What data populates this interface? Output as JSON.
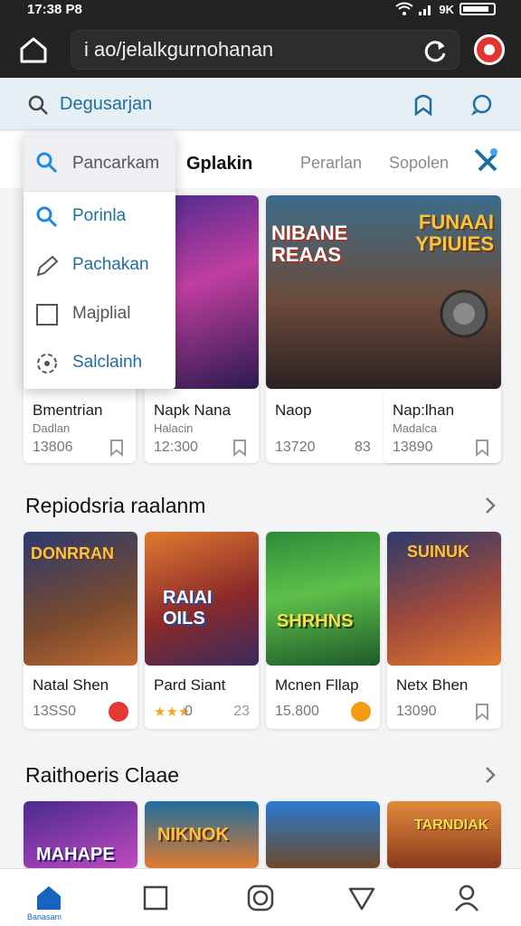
{
  "status": {
    "time": "17:38 P8",
    "signal_text": "9K"
  },
  "browser": {
    "url": "i ao/jelalkgurnohanan"
  },
  "search": {
    "placeholder": "Degusarjan"
  },
  "tabs": [
    {
      "label": "Gplakin",
      "active": true
    },
    {
      "label": "Perarlan",
      "active": false
    },
    {
      "label": "Sopolen",
      "active": false
    }
  ],
  "dropdown": {
    "header": "Pancarkam",
    "items": [
      {
        "label": "Porinla",
        "icon": "search-icon"
      },
      {
        "label": "Pachakan",
        "icon": "pencil-icon"
      },
      {
        "label": "Majplial",
        "icon": "checkbox-icon"
      },
      {
        "label": "Salclainh",
        "icon": "gear-icon"
      }
    ]
  },
  "top_row": [
    {
      "title": "Bmentrian",
      "subtitle": "Dadlan",
      "count": "13806",
      "art_caption": ""
    },
    {
      "title": "Napk Nana",
      "subtitle": "Halacin",
      "count": "12:300",
      "art_caption": ""
    },
    {
      "title": "Naop",
      "subtitle": "",
      "count": "13720",
      "badge": "83",
      "art_caption": "NIBANE REAAS",
      "art_caption2": "FUNAAI YPIUIES"
    },
    {
      "title": "Nap:lhan",
      "subtitle": "Madalca",
      "count": "13890",
      "art_caption": ""
    }
  ],
  "sections": [
    {
      "title": "Repiodsria raalanm"
    },
    {
      "title": "Raithoeris Claae"
    }
  ],
  "recommended": [
    {
      "title": "Natal Shen",
      "count": "13SS0",
      "art_caption": "DONRRAN",
      "badge_color": "#e53935"
    },
    {
      "title": "Pard Siant",
      "count": "0",
      "stars": "★★★",
      "badge_text": "23",
      "art_caption": "RAIAI OILS"
    },
    {
      "title": "Mcnen Fllap",
      "count": "15.800",
      "art_caption": "SHRHNS",
      "badge_color": "#f39c12"
    },
    {
      "title": "Netx Bhen",
      "count": "13090",
      "art_caption": "SUINUK"
    }
  ],
  "bottom_row": [
    {
      "art_caption": "MAHAPE"
    },
    {
      "art_caption": "NIKNOK"
    },
    {
      "art_caption": ""
    },
    {
      "art_caption": "TARNDIAK"
    }
  ],
  "nav": {
    "home_label": "Banasam"
  },
  "colors": {
    "accent": "#1e6ea0",
    "brand_red": "#e3342f",
    "nav_blue": "#1565c0"
  }
}
